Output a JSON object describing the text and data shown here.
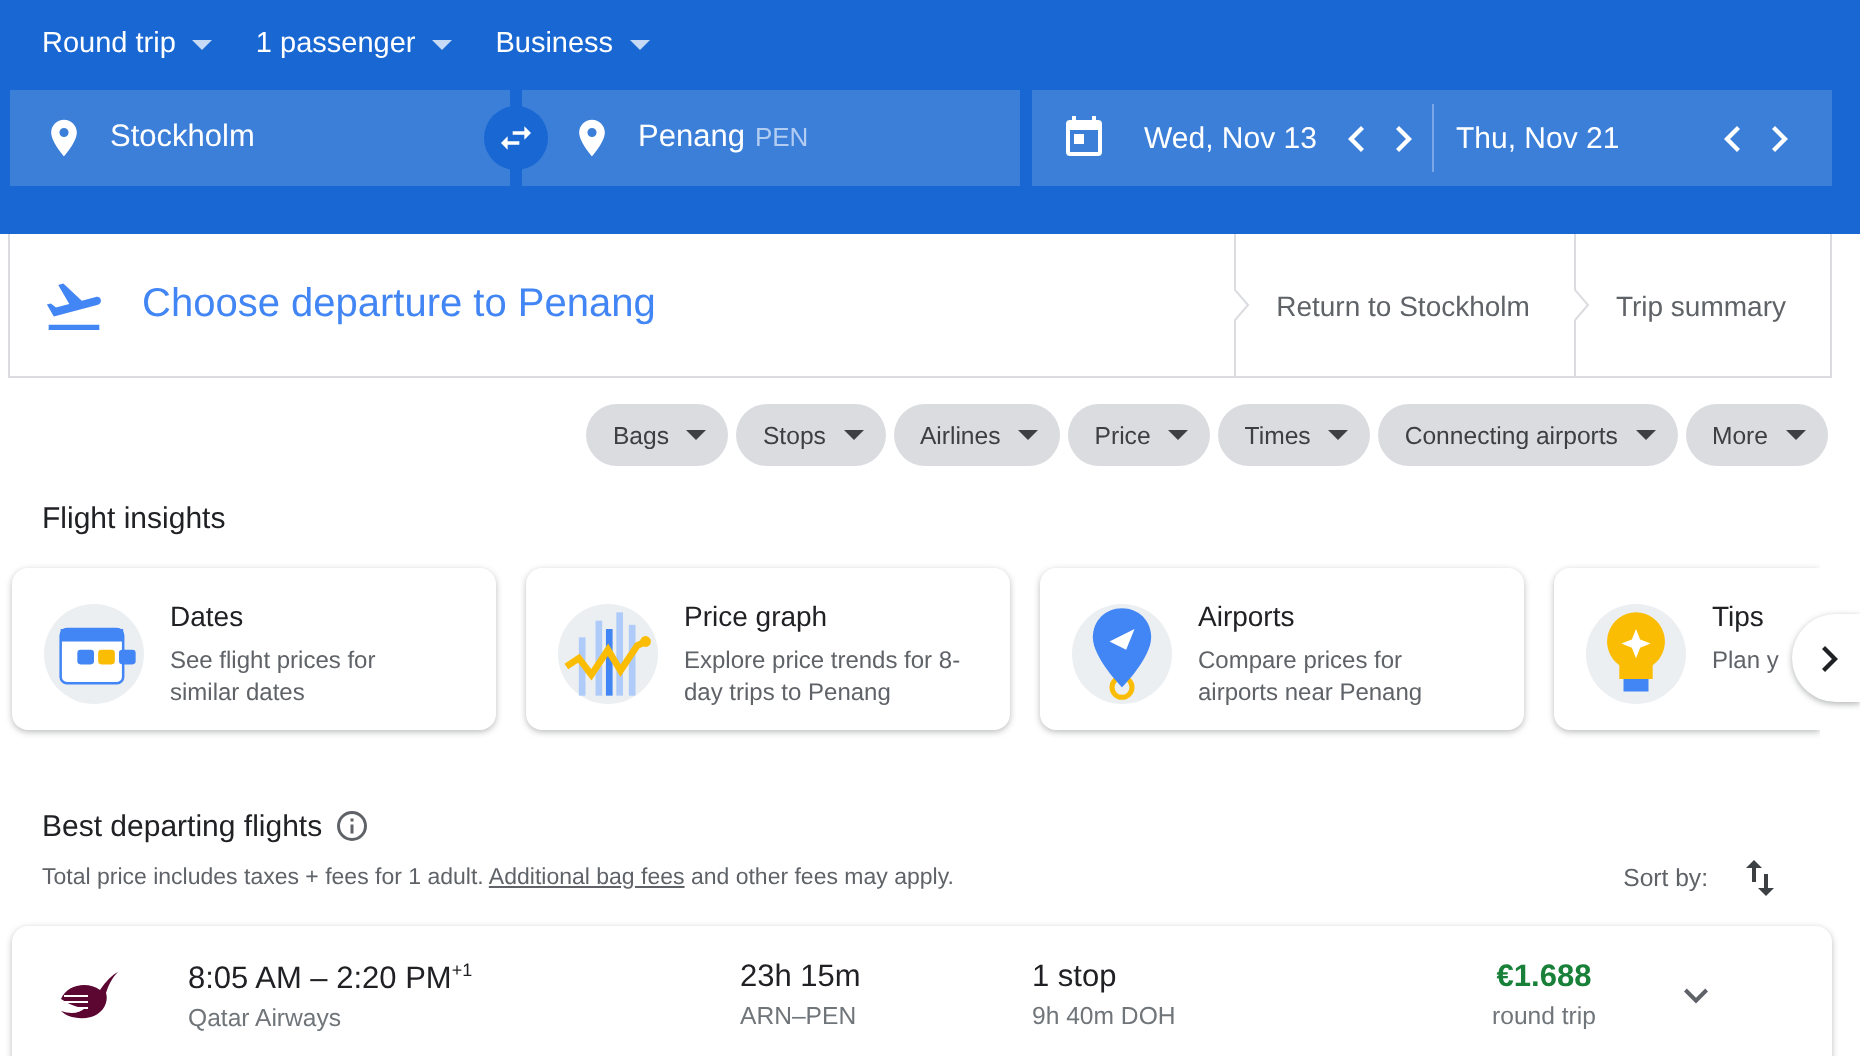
{
  "trip_options": [
    {
      "label": "Round trip"
    },
    {
      "label": "1 passenger"
    },
    {
      "label": "Business"
    }
  ],
  "origin": {
    "value": "Stockholm"
  },
  "destination": {
    "value": "Penang",
    "code": "PEN"
  },
  "dates": [
    {
      "value": "Wed, Nov 13"
    },
    {
      "value": "Thu, Nov 21"
    }
  ],
  "steps": [
    {
      "label": "Choose departure to Penang",
      "selected": true
    },
    {
      "label": "Return to Stockholm",
      "selected": false
    },
    {
      "label": "Trip summary",
      "selected": false
    }
  ],
  "filters": [
    "Bags",
    "Stops",
    "Airlines",
    "Price",
    "Times",
    "Connecting airports",
    "More"
  ],
  "insights": {
    "title": "Flight insights",
    "cards": [
      {
        "kind": "dates",
        "title": "Dates",
        "text": "See flight prices for similar dates"
      },
      {
        "kind": "graph",
        "title": "Price graph",
        "text": "Explore price trends for 8-day trips to Penang"
      },
      {
        "kind": "airports",
        "title": "Airports",
        "text": "Compare prices for airports near Penang"
      },
      {
        "kind": "tips",
        "title": "Tips",
        "text": "Plan y"
      }
    ]
  },
  "results": {
    "title": "Best departing flights",
    "note": "Total price includes taxes + fees for 1 adult.",
    "link": "Additional bag fees",
    "note_end": "and other fees may apply.",
    "sort_label": "Sort by:",
    "flights": [
      {
        "times": "8:05 AM – 2:20 PM",
        "day_offset": "+1",
        "airline": "Qatar Airways",
        "duration": "23h 15m",
        "route": "ARN–PEN",
        "stops": "1 stop",
        "layover": "9h 40m DOH",
        "price": "€1.688",
        "price_note": "round trip"
      }
    ]
  }
}
